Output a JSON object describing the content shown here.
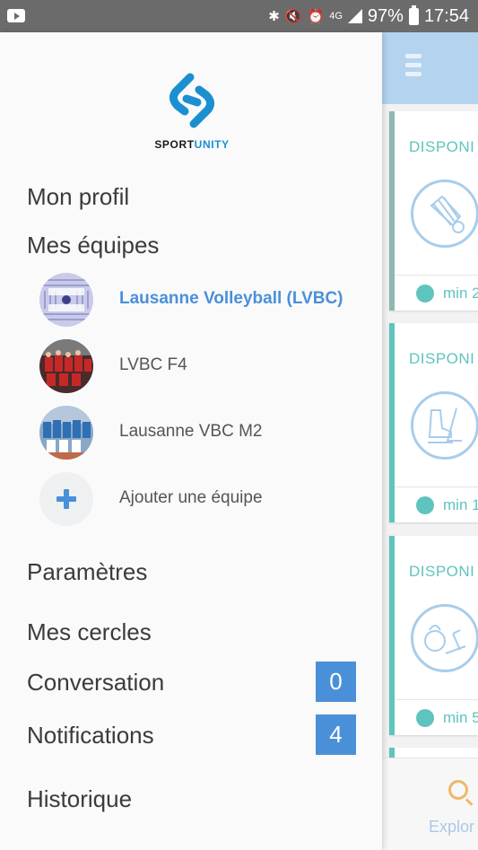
{
  "statusbar": {
    "youtube_icon": "youtube-icon",
    "network": "4G",
    "battery": "97%",
    "time": "17:54"
  },
  "brand": {
    "name_part1": "SPORT",
    "name_part2": "UNITY",
    "colors": {
      "accent": "#1b8fd0",
      "dark": "#1a1a1a"
    }
  },
  "drawer": {
    "items": {
      "profile": "Mon profil",
      "teams": "Mes équipes",
      "settings": "Paramètres",
      "circles": "Mes cercles",
      "conversation": "Conversation",
      "notifications": "Notifications",
      "history": "Historique"
    },
    "teams": [
      {
        "name": "Lausanne Volleyball (LVBC)",
        "active": true
      },
      {
        "name": "LVBC F4",
        "active": false
      },
      {
        "name": "Lausanne VBC M2",
        "active": false
      }
    ],
    "add_team": "Ajouter une équipe",
    "badges": {
      "conversation": "0",
      "notifications": "4"
    },
    "colors": {
      "active_team": "#4a90d9",
      "badge_bg": "#4a90d9",
      "text": "#3b3b3b"
    }
  },
  "background_app": {
    "cards": [
      {
        "title": "DISPONI",
        "footer": "min 2",
        "icon": "badminton-shuttlecock-icon"
      },
      {
        "title": "DISPONI",
        "footer": "min 1",
        "icon": "ice-hockey-icon"
      },
      {
        "title": "DISPONI",
        "footer": "min 5",
        "icon": "fitness-kettlebell-treadmill-icon"
      }
    ],
    "explore_label": "Explor",
    "colors": {
      "topbar": "#b4d3ef",
      "teal": "#5fc4bd",
      "card_border": "#6db7ad"
    }
  }
}
